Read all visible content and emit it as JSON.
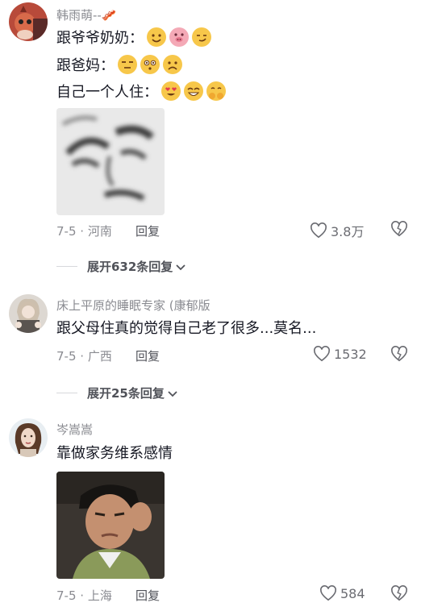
{
  "comments": [
    {
      "username": "韩雨萌--🥓",
      "lines": [
        {
          "text": "跟爷爷奶奶：",
          "emojis": [
            "smile-emoji",
            "pig-emoji",
            "smirk-emoji"
          ]
        },
        {
          "text": "跟爸妈：",
          "emojis": [
            "unamused-emoji",
            "flushed-emoji",
            "frown-emoji"
          ]
        },
        {
          "text": "自己一个人住：",
          "emojis": [
            "heart-eyes-emoji",
            "grin-emoji",
            "hug-emoji"
          ]
        }
      ],
      "date": "7-5",
      "location": "河南",
      "reply": "回复",
      "likes": "3.8万",
      "expand": "展开632条回复"
    },
    {
      "username": "床上平原的睡眠专家 (康郁版",
      "text": "跟父母住真的觉得自己老了很多...莫名...",
      "date": "7-5",
      "location": "广西",
      "reply": "回复",
      "likes": "1532",
      "expand": "展开25条回复"
    },
    {
      "username": "岑嵩嵩",
      "text": "靠做家务维系感情",
      "date": "7-5",
      "location": "上海",
      "reply": "回复",
      "likes": "584"
    }
  ],
  "colors": {
    "text": "#161823",
    "muted": "#8a8b91",
    "divider": "#d7d8dc"
  }
}
